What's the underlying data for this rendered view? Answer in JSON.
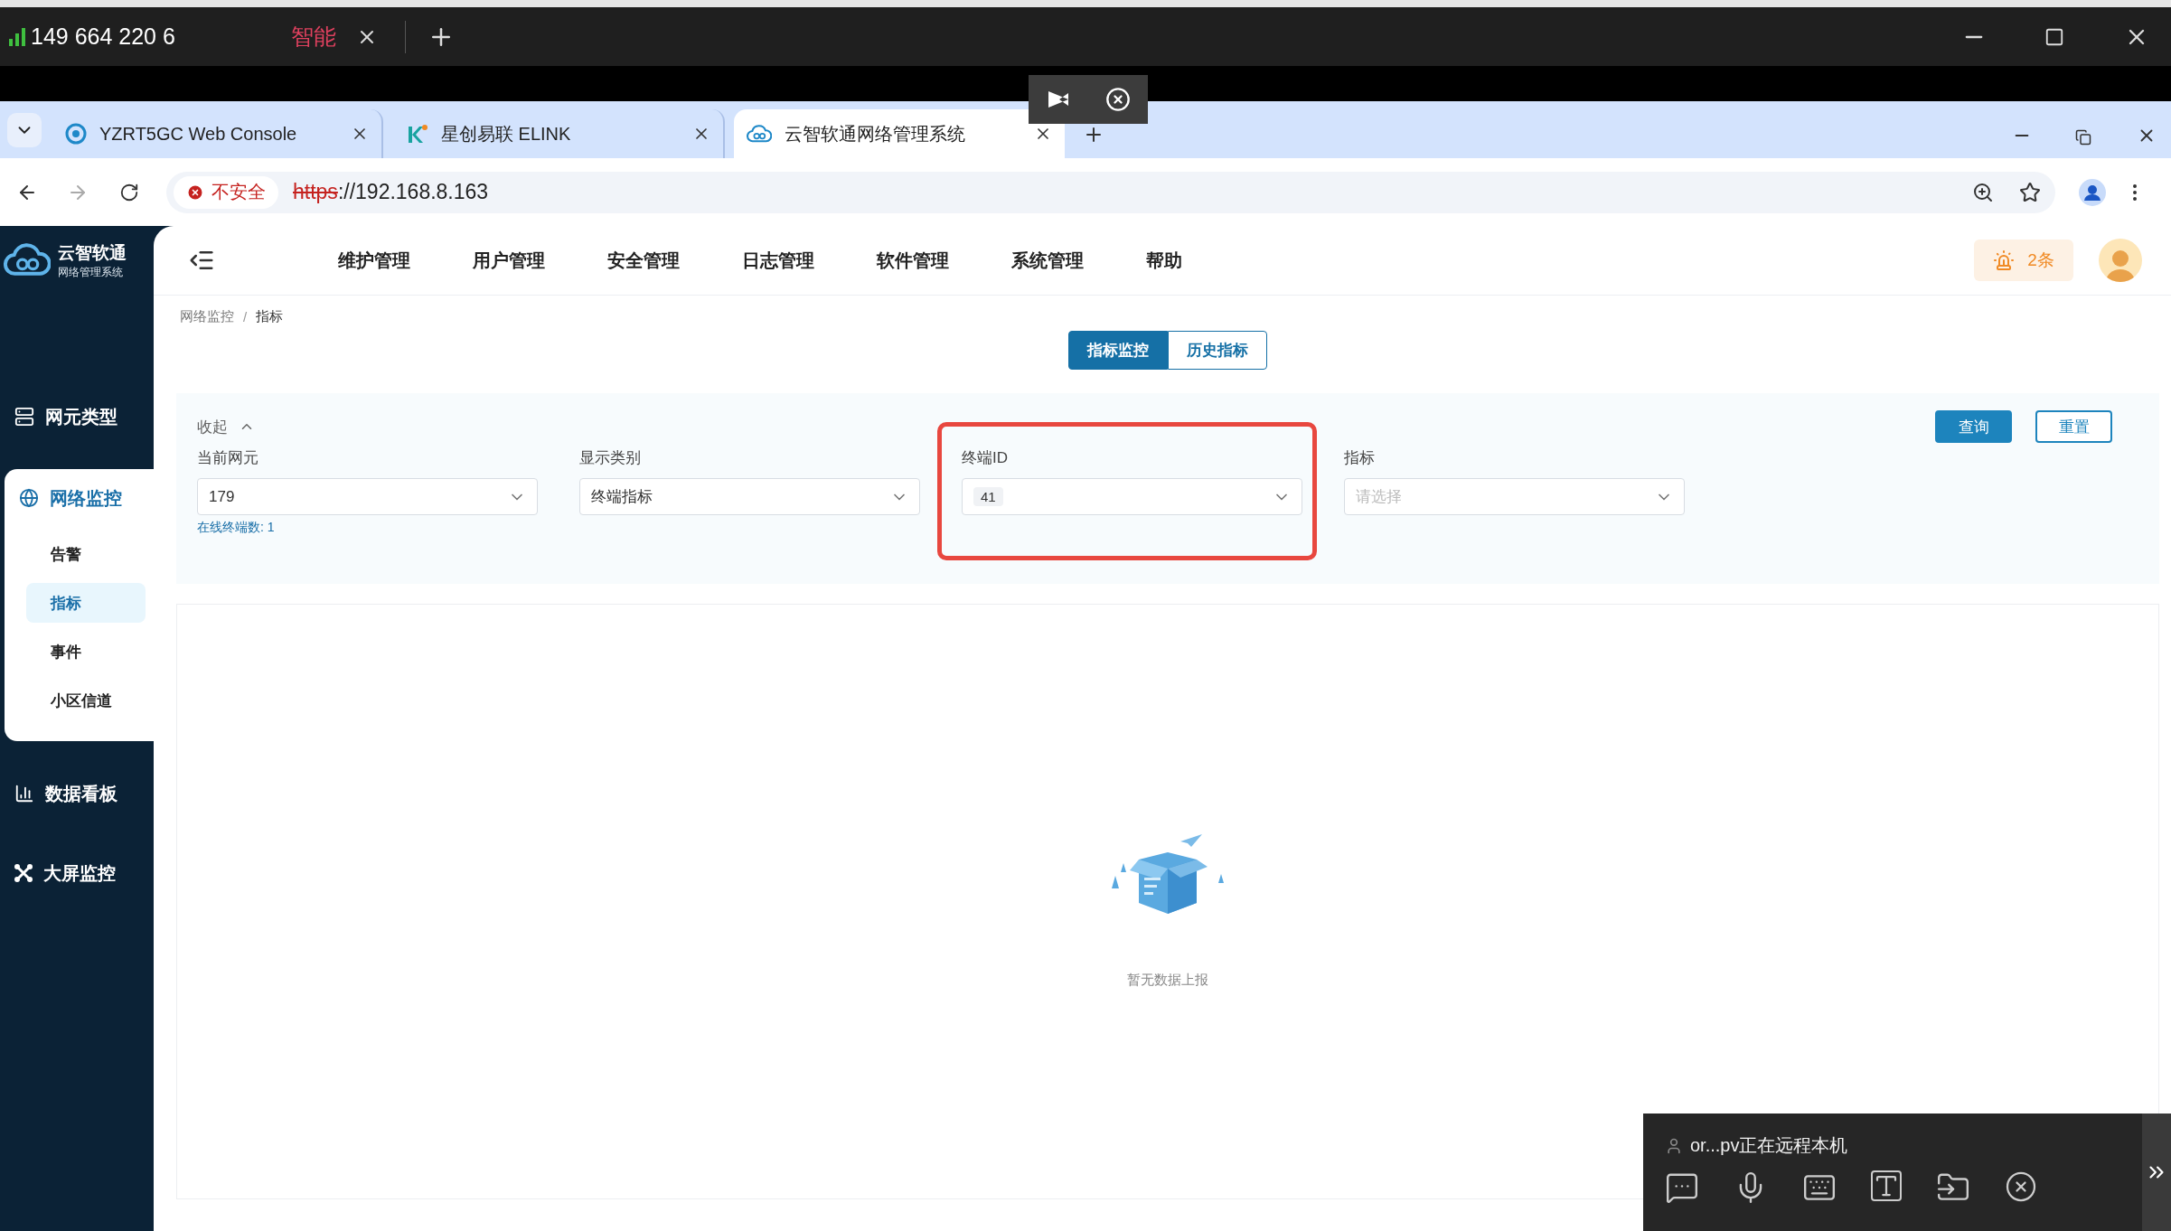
{
  "remote_bar": {
    "session_id": "149 664 220 6",
    "tab": "智能"
  },
  "browser": {
    "tabs": [
      {
        "title": "YZRT5GC Web Console",
        "selected": false
      },
      {
        "title": "星创易联 ELINK",
        "selected": false
      },
      {
        "title": "云智软通网络管理系统",
        "selected": true
      }
    ],
    "security": "不安全",
    "url_scheme": "https",
    "url_rest": "://192.168.8.163"
  },
  "app": {
    "logo_title": "云智软通",
    "logo_subtitle": "网络管理系统",
    "nav": [
      "维护管理",
      "用户管理",
      "安全管理",
      "日志管理",
      "软件管理",
      "系统管理",
      "帮助"
    ],
    "sidebar": [
      {
        "label": "网元类型",
        "expanded": false
      },
      {
        "label": "网络监控",
        "expanded": true,
        "children": [
          {
            "label": "告警",
            "selected": false
          },
          {
            "label": "指标",
            "selected": true
          },
          {
            "label": "事件",
            "selected": false
          },
          {
            "label": "小区信道",
            "selected": false
          }
        ]
      },
      {
        "label": "数据看板",
        "expanded": false
      },
      {
        "label": "大屏监控",
        "expanded": false
      }
    ],
    "alarm": "2条",
    "breadcrumb": [
      "网络监控",
      "指标"
    ],
    "breadcrumb_separator": "/",
    "view_tabs": [
      {
        "label": "指标监控",
        "selected": true
      },
      {
        "label": "历史指标",
        "selected": false
      }
    ],
    "collapse": "收起",
    "filters": [
      {
        "label": "当前网元",
        "value": "179",
        "note": "在线终端数: 1",
        "highlighted": false
      },
      {
        "label": "显示类别",
        "value": "终端指标",
        "highlighted": false
      },
      {
        "label": "终端ID",
        "tag": "41",
        "highlighted": true
      },
      {
        "label": "指标",
        "placeholder": "请选择",
        "highlighted": false
      }
    ],
    "buttons": [
      {
        "label": "查询",
        "kind": "primary"
      },
      {
        "label": "重置",
        "kind": "outline"
      }
    ],
    "empty_text": "暂无数据上报"
  },
  "remote_panel": {
    "status": "or...pv正在远程本机"
  }
}
